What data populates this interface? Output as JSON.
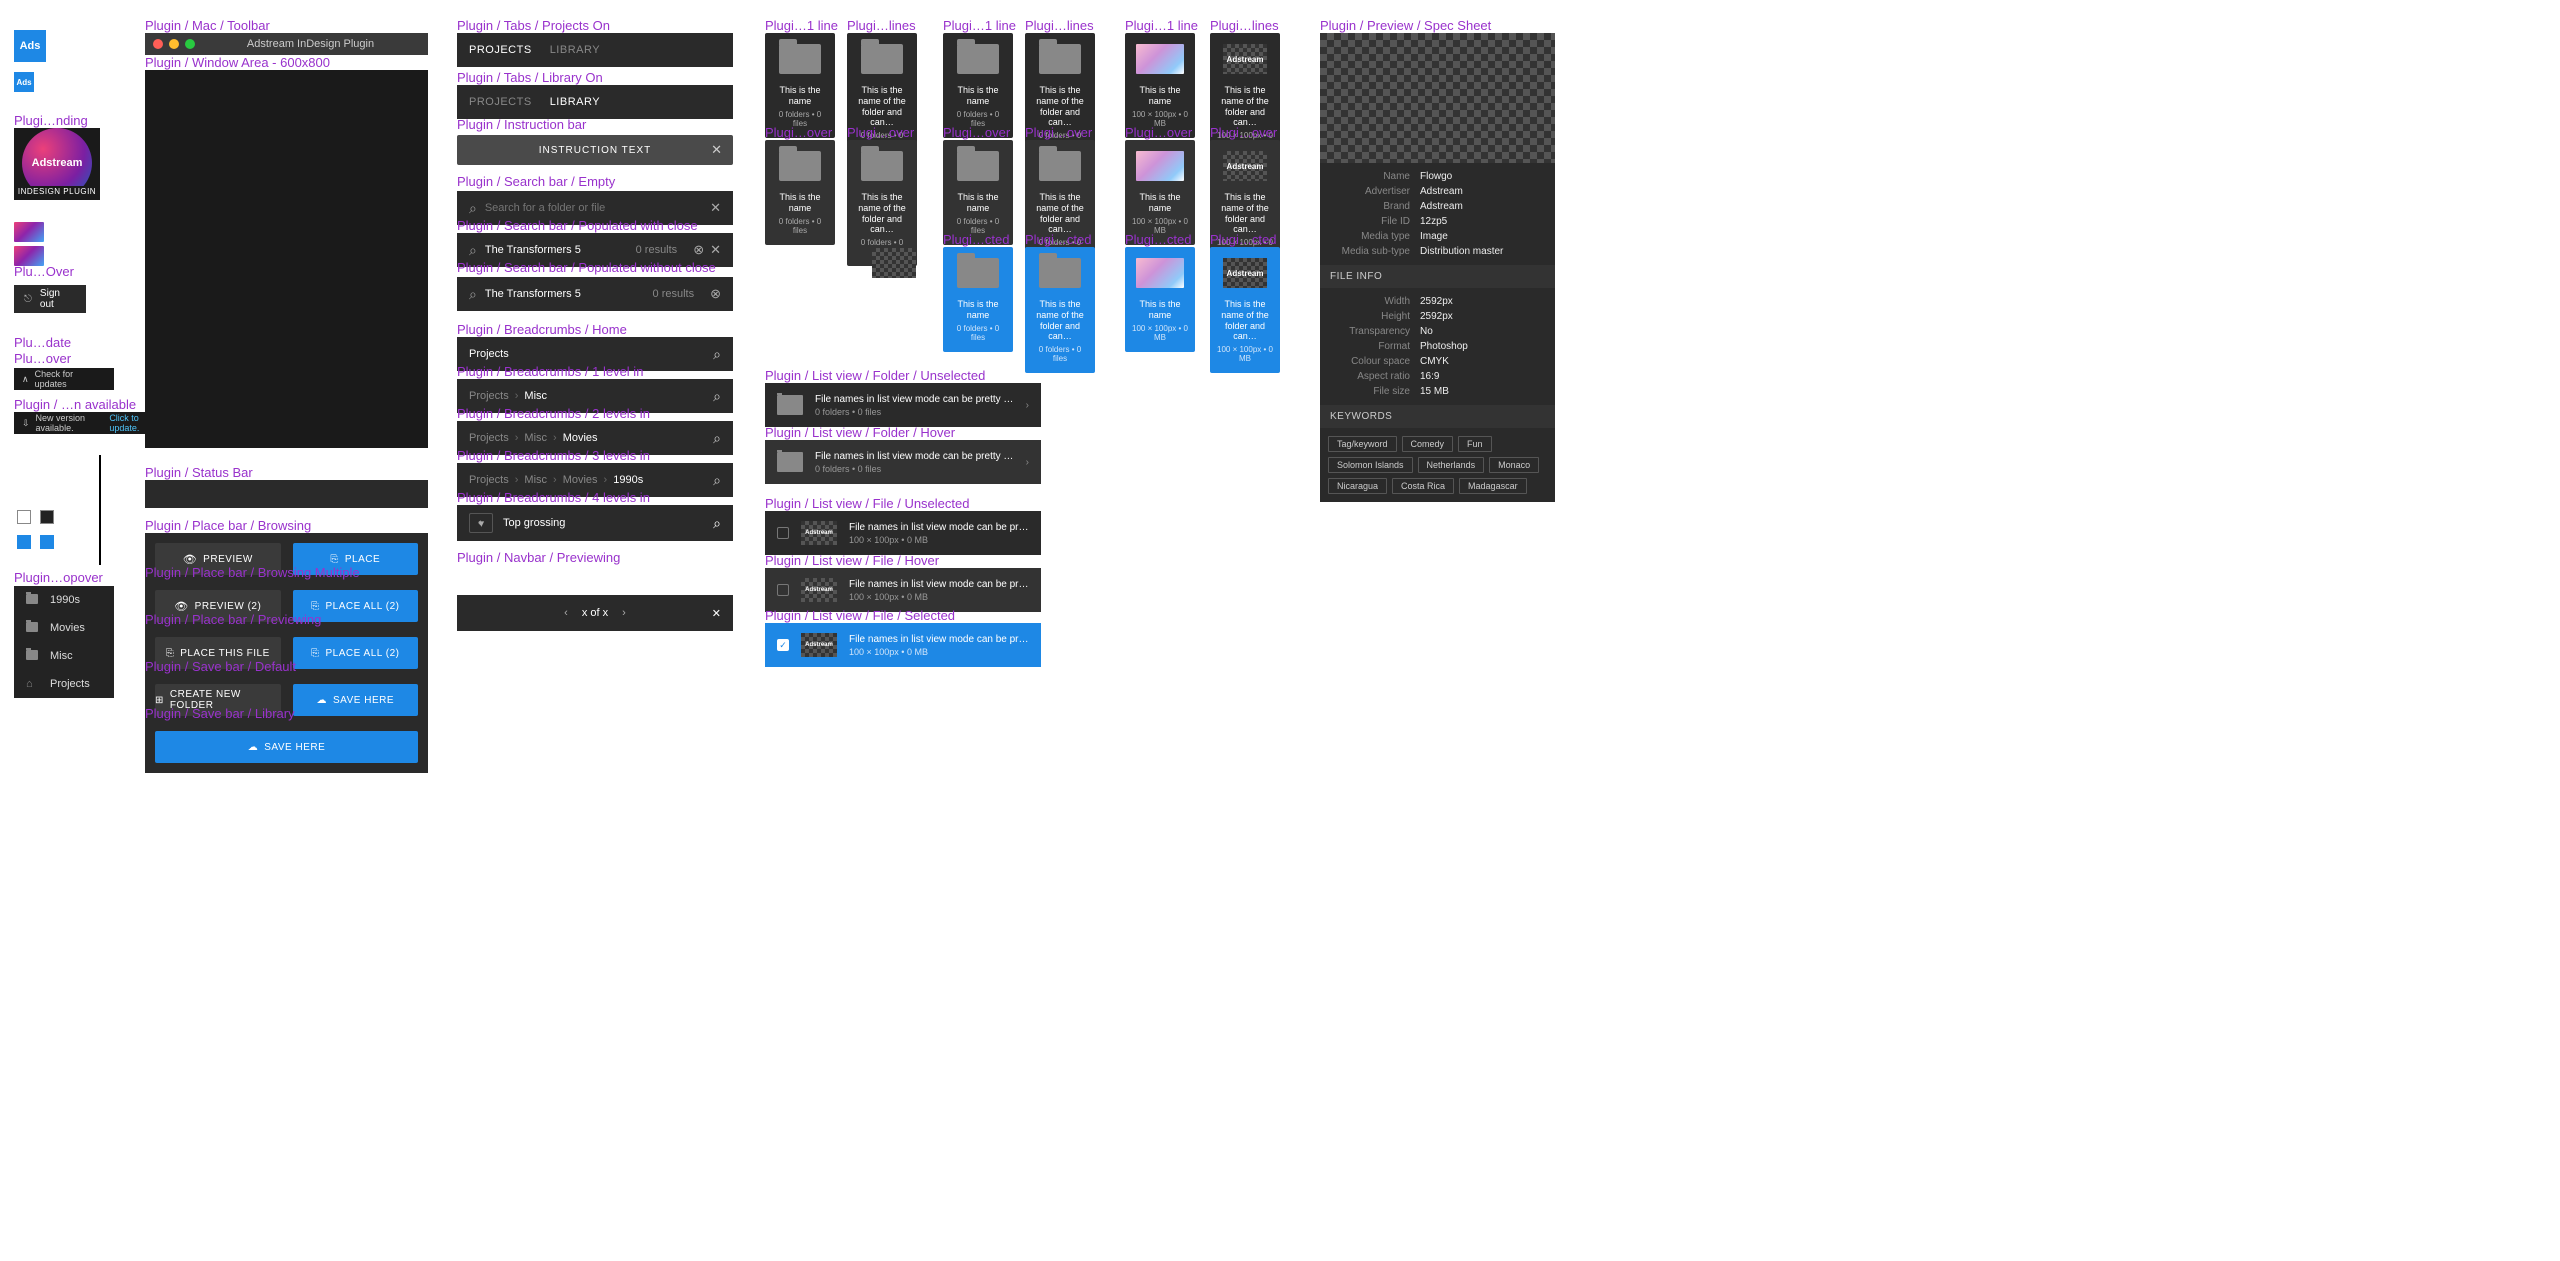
{
  "labels": {
    "toolbar": "Plugin / Mac / Toolbar",
    "window": "Plugin / Window Area - 600x800",
    "landing": "Plugi…nding",
    "lover": "Plu…Over",
    "ldate": "Plu…date",
    "lhover": "Plu…over",
    "lavail": "Plugin / …n available",
    "popover": "Plugin…opover",
    "status": "Plugin / Status Bar",
    "pb_browse": "Plugin / Place bar / Browsing",
    "pb_multi": "Plugin / Place bar / Browsing Multiple",
    "pb_prev": "Plugin / Place bar / Previewing",
    "sb_def": "Plugin / Save bar / Default",
    "sb_lib": "Plugin / Save bar / Library",
    "tabs_p": "Plugin / Tabs / Projects On",
    "tabs_l": "Plugin / Tabs / Library On",
    "instr": "Plugin / Instruction bar",
    "srch_e": "Plugin / Search bar / Empty",
    "srch_pc": "Plugin / Search bar / Populated with close",
    "srch_p": "Plugin / Search bar / Populated without close",
    "bc_h": "Plugin / Breadcrumbs / Home",
    "bc_1": "Plugin / Breadcrumbs / 1 level in",
    "bc_2": "Plugin / Breadcrumbs / 2 levels in",
    "bc_3": "Plugin / Breadcrumbs / 3 levels in",
    "bc_4": "Plugin / Breadcrumbs / 4 levels in",
    "nav": "Plugin / Navbar / Previewing",
    "t1": "Plugi…1 line",
    "t2": "Plugi…lines",
    "t3": "Plugi…1 line",
    "t4": "Plugi…lines",
    "t5": "Plugi…1 line",
    "t6": "Plugi…lines",
    "to1": "Plugi…over",
    "to2": "Plugi…over",
    "to3": "Plugi…over",
    "to4": "Plugi…over",
    "to5": "Plugi…over",
    "to6": "Plugi…over",
    "ts1": "Plugi…cted",
    "ts2": "Plugi…cted",
    "ts3": "Plugi…cted",
    "ts4": "Plugi…cted",
    "lv_fu": "Plugin / List view / Folder / Unselected",
    "lv_fh": "Plugin / List view / Folder / Hover",
    "lv_iu": "Plugin / List view / File / Unselected",
    "lv_ih": "Plugin / List view / File / Hover",
    "lv_is": "Plugin / List view / File / Selected",
    "spec": "Plugin / Preview / Spec Sheet"
  },
  "ads": "Ads",
  "toolbar": {
    "title": "Adstream InDesign Plugin"
  },
  "landing": {
    "brand": "Adstream",
    "sub": "INDESIGN PLUGIN"
  },
  "signout": "Sign out",
  "update_check": "Check for updates",
  "update_avail": "New version available.",
  "update_link": "Click to update.",
  "popover": {
    "items": [
      "1990s",
      "Movies",
      "Misc",
      "Projects"
    ]
  },
  "placebar": {
    "preview": "PREVIEW",
    "place": "PLACE",
    "preview2": "PREVIEW (2)",
    "placeall2": "PLACE ALL (2)",
    "placethis": "PLACE THIS FILE",
    "newfolder": "CREATE NEW FOLDER",
    "savehere": "SAVE HERE"
  },
  "tabs": {
    "projects": "PROJECTS",
    "library": "LIBRARY"
  },
  "instr_text": "INSTRUCTION TEXT",
  "search": {
    "placeholder": "Search for a folder or file",
    "query": "The Transformers 5",
    "results": "0 results"
  },
  "crumbs": {
    "home": "Projects",
    "l1": "Misc",
    "l2": "Movies",
    "l3": "1990s",
    "l4": "Top grossing"
  },
  "nav": {
    "page": "x of x"
  },
  "tile": {
    "n1": "This is the name",
    "m1": "0 folders • 0 files",
    "n2": "This is the name of the folder and can…",
    "m2": "0 folders • 0 files",
    "fm": "100 × 100px • 0 MB",
    "brand": "Adstream"
  },
  "list": {
    "fname": "File names in list view mode can be pretty long and…",
    "fmeta": "0 folders • 0 files",
    "iname": "File names in list view mode can be pretty long and hav…",
    "imeta": "100 × 100px • 0 MB",
    "brand": "Adstream"
  },
  "spec": {
    "g1": [
      [
        "Name",
        "Flowgo"
      ],
      [
        "Advertiser",
        "Adstream"
      ],
      [
        "Brand",
        "Adstream"
      ],
      [
        "File ID",
        "12zp5"
      ],
      [
        "Media type",
        "Image"
      ],
      [
        "Media sub-type",
        "Distribution master"
      ]
    ],
    "h2": "FILE INFO",
    "g2": [
      [
        "Width",
        "2592px"
      ],
      [
        "Height",
        "2592px"
      ],
      [
        "Transparency",
        "No"
      ],
      [
        "Format",
        "Photoshop"
      ],
      [
        "Colour space",
        "CMYK"
      ],
      [
        "Aspect ratio",
        "16:9"
      ],
      [
        "File size",
        "15 MB"
      ]
    ],
    "h3": "KEYWORDS",
    "tags": [
      "Tag/keyword",
      "Comedy",
      "Fun",
      "Solomon Islands",
      "Netherlands",
      "Monaco",
      "Nicaragua",
      "Costa Rica",
      "Madagascar"
    ]
  }
}
